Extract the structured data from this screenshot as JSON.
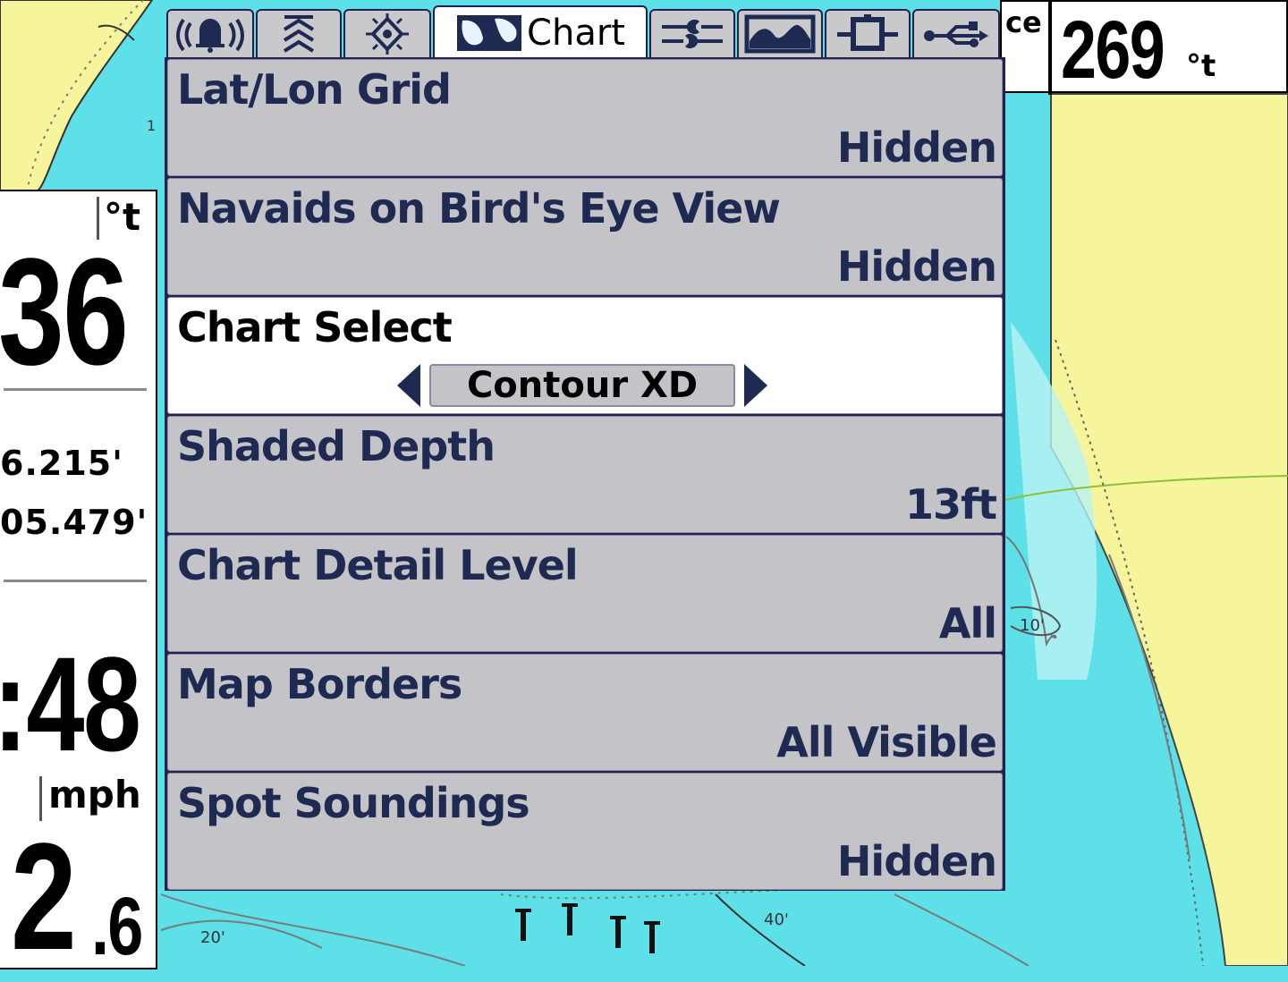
{
  "tabs": [
    {
      "name": "alarms-icon",
      "label": ""
    },
    {
      "name": "sonar-icon",
      "label": ""
    },
    {
      "name": "navigation-icon",
      "label": ""
    },
    {
      "name": "chart-icon",
      "label": "Chart",
      "active": true
    },
    {
      "name": "setup-icon",
      "label": ""
    },
    {
      "name": "views-icon",
      "label": ""
    },
    {
      "name": "accessories-icon",
      "label": ""
    },
    {
      "name": "network-icon",
      "label": ""
    }
  ],
  "menu": {
    "items": [
      {
        "label": "Lat/Lon Grid",
        "value": "Hidden"
      },
      {
        "label": "Navaids on Bird's Eye View",
        "value": "Hidden"
      },
      {
        "label": "Chart Select",
        "value": "Contour XD"
      },
      {
        "label": "Shaded Depth",
        "value": "13ft"
      },
      {
        "label": "Chart Detail Level",
        "value": "All"
      },
      {
        "label": "Map Borders",
        "value": "All Visible"
      },
      {
        "label": "Spot Soundings",
        "value": "Hidden"
      }
    ]
  },
  "top_right_box": {
    "label_fragment": "ce",
    "value": "269",
    "unit": "°t"
  },
  "left_panel": {
    "unit_top": "°t",
    "heading_value": "36",
    "coord1": "6.215'",
    "coord2": "05.479'",
    "speed_value": ":48",
    "speed_unit": "mph",
    "depth_big": "2",
    "depth_small": ".6"
  },
  "map_labels": {
    "depth_10": "10'",
    "depth_20": "20'",
    "depth_40": "40'",
    "edge_number": "1"
  },
  "colors": {
    "water": "#5ee0e8",
    "shallow_water": "#b9f3f3",
    "land": "#f6f59b",
    "menu_border": "#22224f",
    "menu_item_bg": "#c4c4c8",
    "menu_text": "#1e2a52"
  }
}
